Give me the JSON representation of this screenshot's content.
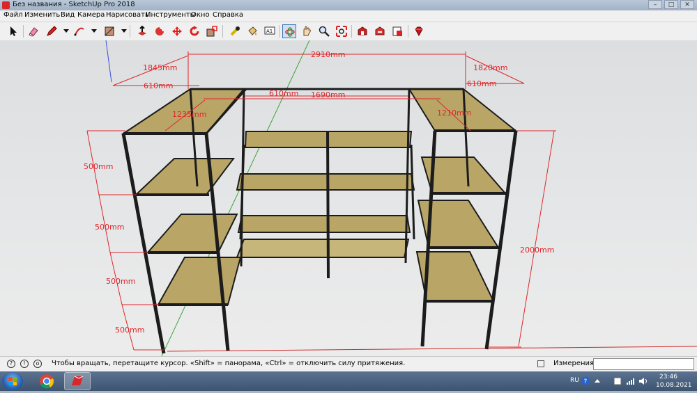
{
  "window": {
    "title": "Без названия - SketchUp Pro 2018",
    "minimize": "–",
    "maximize": "□",
    "close": "✕"
  },
  "menu": {
    "items": [
      "Файл",
      "Изменить",
      "Вид",
      "Камера",
      "Нарисовать",
      "Инструменты",
      "Окно",
      "Справка"
    ]
  },
  "toolbar": {
    "tools": [
      {
        "name": "select-icon"
      },
      {
        "name": "eraser-icon"
      },
      {
        "name": "pencil-icon"
      },
      {
        "name": "arc-icon"
      },
      {
        "name": "rectangle-icon"
      },
      {
        "name": "push-pull-icon"
      },
      {
        "name": "follow-me-icon"
      },
      {
        "name": "move-icon"
      },
      {
        "name": "rotate-icon"
      },
      {
        "name": "scale-icon"
      },
      {
        "name": "tape-measure-icon"
      },
      {
        "name": "paint-bucket-icon"
      },
      {
        "name": "text-icon"
      },
      {
        "name": "orbit-icon"
      },
      {
        "name": "pan-icon"
      },
      {
        "name": "zoom-icon"
      },
      {
        "name": "zoom-extents-icon"
      },
      {
        "name": "3d-warehouse-icon"
      },
      {
        "name": "extension-warehouse-icon"
      },
      {
        "name": "layout-icon"
      },
      {
        "name": "ruby-icon"
      }
    ],
    "active_tool": "orbit-icon"
  },
  "model": {
    "dimensions": {
      "total_width": "2910mm",
      "left_depth": "1845mm",
      "right_depth": "1820mm",
      "left_shelf_width": "610mm",
      "right_shelf_width": "610mm",
      "center_shelf_width": "610mm",
      "center_span": "1690mm",
      "left_inner": "1235mm",
      "right_inner": "1210mm",
      "height_total": "2000mm",
      "shelf_gap_1": "500mm",
      "shelf_gap_2": "500mm",
      "shelf_gap_3": "500mm",
      "shelf_gap_4": "500mm"
    },
    "colors": {
      "frame": "#1c1c1c",
      "shelf": "#b9a667",
      "dimension": "#e0262a",
      "axis_green": "#3aa53a",
      "axis_blue": "#3b4fd0",
      "axis_red": "#cf2a2a"
    }
  },
  "status": {
    "hint": "Чтобы вращать, перетащите курсор. «Shift» = панорама, «Ctrl» = отключить силу притяжения.",
    "measurements_label": "Измерения",
    "measurements_value": ""
  },
  "taskbar": {
    "language": "RU",
    "time": "23:46",
    "date": "10.08.2021"
  }
}
